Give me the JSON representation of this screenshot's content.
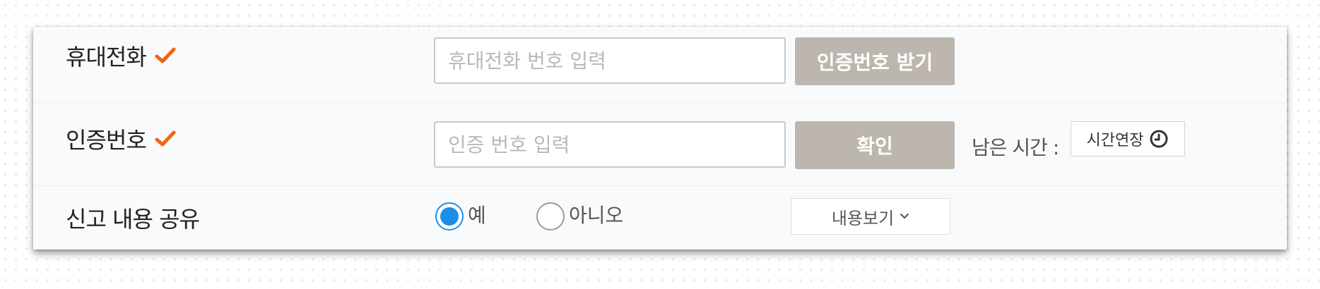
{
  "colors": {
    "accent_check": "#f06414",
    "button_bg": "#bdb6ae",
    "radio_selected": "#1b8fe8"
  },
  "phone_row": {
    "label": "휴대전화",
    "required_icon": "check-icon",
    "input_placeholder": "휴대전화 번호 입력",
    "input_value": "",
    "button_label": "인증번호 받기"
  },
  "code_row": {
    "label": "인증번호",
    "required_icon": "check-icon",
    "input_placeholder": "인증 번호 입력",
    "input_value": "",
    "button_label": "확인",
    "remaining_time_label": "남은 시간 :",
    "extend_button_label": "시간연장",
    "extend_icon": "clock-icon"
  },
  "share_row": {
    "label": "신고 내용 공유",
    "options": [
      {
        "label": "예",
        "selected": true
      },
      {
        "label": "아니오",
        "selected": false
      }
    ],
    "view_button_label": "내용보기",
    "view_icon": "chevron-down-icon"
  }
}
